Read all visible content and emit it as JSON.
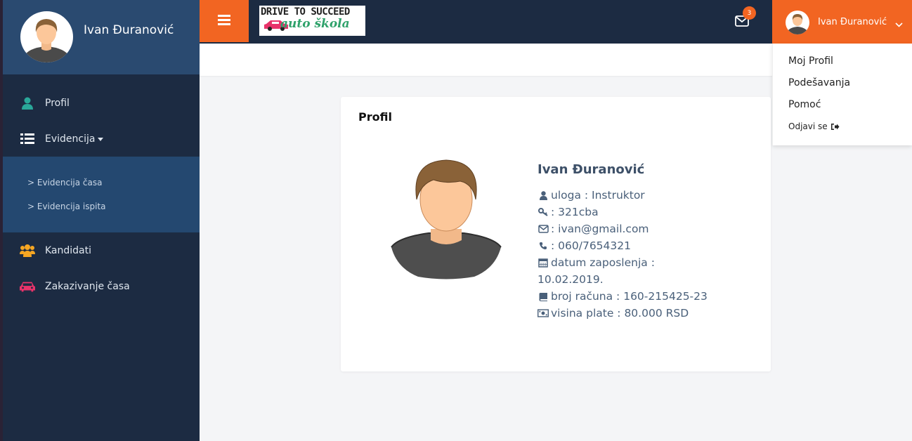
{
  "user": {
    "name": "Ivan Đuranović"
  },
  "sidebar": {
    "items": [
      {
        "label": "Profil",
        "icon": "user-icon"
      },
      {
        "label": "Evidencija",
        "icon": "list-icon"
      },
      {
        "label": "Kandidati",
        "icon": "users-icon"
      },
      {
        "label": "Zakazivanje časa",
        "icon": "car-icon"
      }
    ],
    "submenu": [
      {
        "label": "> Evidencija časa"
      },
      {
        "label": "> Evidencija ispita"
      }
    ]
  },
  "topbar": {
    "logo_line1": "DRIVE TO SUCCEED",
    "logo_line2": "auto škola",
    "notification_count": "3"
  },
  "dropdown": {
    "items": [
      {
        "label": "Moj Profil"
      },
      {
        "label": "Podešavanja"
      },
      {
        "label": "Pomoć"
      },
      {
        "label": "Odjavi se"
      }
    ]
  },
  "profile": {
    "card_title": "Profil",
    "name": "Ivan Đuranović",
    "role": "uloga : Instruktor",
    "password": ": 321cba",
    "email": ": ivan@gmail.com",
    "phone": ": 060/7654321",
    "hire_date_label": "datum zaposlenja :",
    "hire_date": "10.02.2019.",
    "account": "broj računa : 160-215425-23",
    "salary": "visina plate : 80.000 RSD"
  },
  "colors": {
    "accent": "#f26522",
    "sidebar": "#1c2b42",
    "sidebar_head": "#2a4a70",
    "profil_icon": "#2aa89a",
    "kandidati_icon": "#f5a623",
    "car_icon": "#e8336a"
  }
}
